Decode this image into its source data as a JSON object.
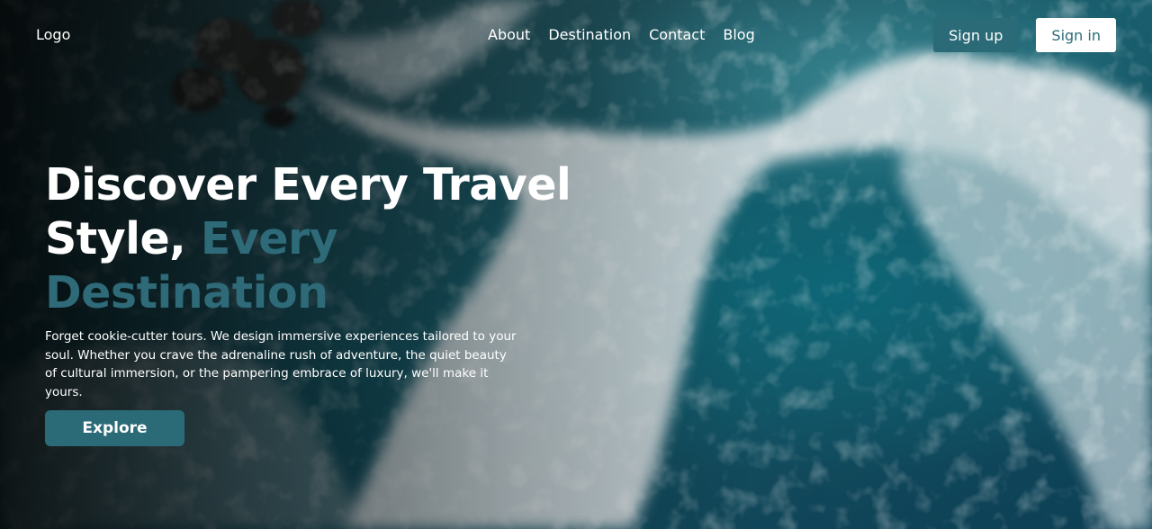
{
  "nav": {
    "logo": "Logo",
    "links": [
      "About",
      "Destination",
      "Contact",
      "Blog"
    ],
    "signup_label": "Sign up",
    "signin_label": "Sign in"
  },
  "hero": {
    "headline_line1": "Discover Every Travel",
    "headline_line2_plain": "Style, ",
    "headline_line2_accent": "Every Destination",
    "description": "Forget cookie-cutter tours. We design immersive experiences tailored to your soul. Whether you crave the adrenaline rush of adventure, the quiet beauty of cultural immersion, or the pampering embrace of luxury, we'll make it yours.",
    "explore_label": "Explore"
  },
  "colors": {
    "accent": "#2b6b77",
    "headline_accent": "#2e6a78",
    "text": "#ffffff"
  }
}
